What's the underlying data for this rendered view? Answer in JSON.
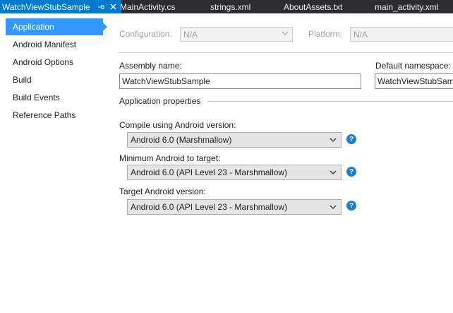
{
  "tabs": [
    {
      "label": "WatchViewStubSample",
      "active": true
    },
    {
      "label": "MainActivity.cs",
      "active": false
    },
    {
      "label": "strings.xml",
      "active": false
    },
    {
      "label": "AboutAssets.txt",
      "active": false
    },
    {
      "label": "main_activity.xml",
      "active": false
    }
  ],
  "tab_icons": {
    "pin": "pin-icon",
    "close": "close-icon"
  },
  "nav": {
    "items": [
      {
        "label": "Application",
        "selected": true
      },
      {
        "label": "Android Manifest"
      },
      {
        "label": "Android Options"
      },
      {
        "label": "Build"
      },
      {
        "label": "Build Events"
      },
      {
        "label": "Reference Paths"
      }
    ]
  },
  "config": {
    "configuration_label": "Configuration:",
    "configuration_value": "N/A",
    "platform_label": "Platform:",
    "platform_value": "N/A"
  },
  "main": {
    "assembly_name_label": "Assembly name:",
    "assembly_name_value": "WatchViewStubSample",
    "default_namespace_label": "Default namespace:",
    "default_namespace_value": "WatchViewStubSample",
    "section_title": "Application properties",
    "compile_label": "Compile using Android version:",
    "compile_value": "Android 6.0 (Marshmallow)",
    "min_label": "Minimum Android to target:",
    "min_value": "Android 6.0 (API Level 23 - Marshmallow)",
    "target_label": "Target Android version:",
    "target_value": "Android 6.0 (API Level 23 - Marshmallow)",
    "help_glyph": "?"
  },
  "colors": {
    "accent": "#007acc",
    "selection": "#3399ff",
    "tabstrip": "#2d2d30",
    "help": "#1e7ed3"
  }
}
